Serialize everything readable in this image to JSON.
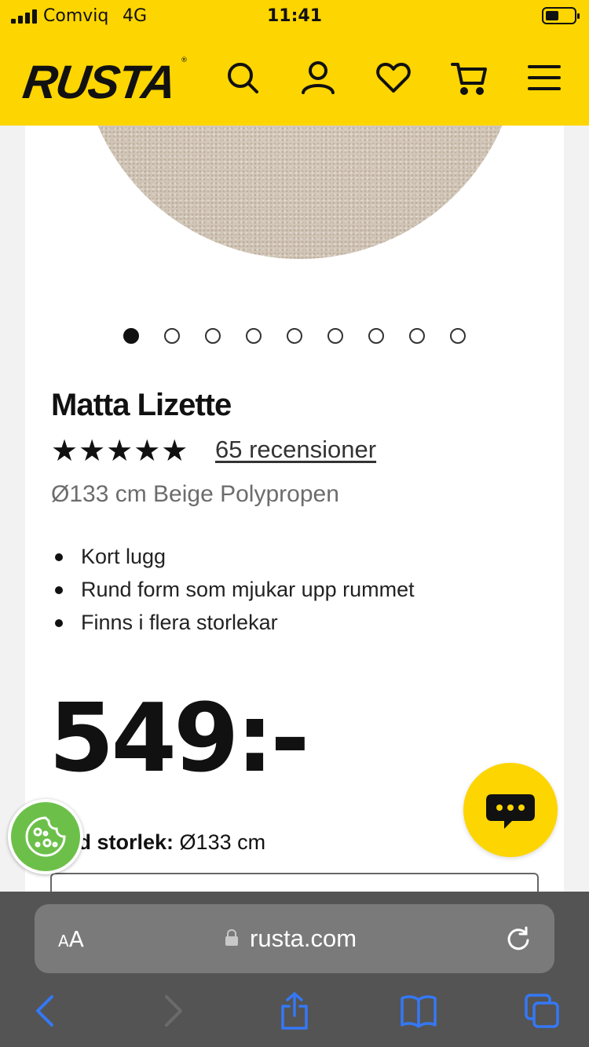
{
  "status_bar": {
    "carrier": "Comviq",
    "network": "4G",
    "time": "11:41"
  },
  "header": {
    "logo": "RUSTA",
    "logo_mark": "®",
    "icons": [
      "search-icon",
      "account-icon",
      "favorites-icon",
      "cart-icon",
      "menu-icon"
    ]
  },
  "gallery": {
    "image_count": 9,
    "active_index": 0
  },
  "product": {
    "title": "Matta Lizette",
    "stars": "★★★★★",
    "rating": 5,
    "reviews_label": "65 recensioner",
    "subtitle": "Ø133 cm Beige Polypropen",
    "features": [
      "Kort lugg",
      "Rund form som mjukar upp rummet",
      "Finns i flera storlekar"
    ],
    "price": "549:-",
    "size_label_partial": "ld storlek:",
    "size_value": "Ø133 cm"
  },
  "browser": {
    "aa_label_small": "A",
    "aa_label_large": "A",
    "url": "rusta.com"
  },
  "colors": {
    "brand_yellow": "#fdd500",
    "cookie_green": "#6cc04a",
    "safari_bar": "#545454",
    "ios_blue": "#3478f6"
  }
}
